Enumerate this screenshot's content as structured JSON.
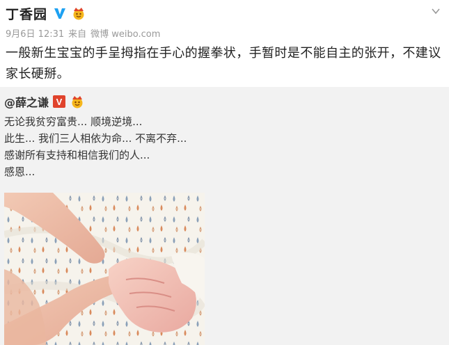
{
  "post": {
    "author": "丁香园",
    "time": "9月6日 12:31",
    "source_prefix": "来自",
    "source": "微博 weibo.com",
    "text": "一般新生宝宝的手呈拇指在手心的握拳状，手暂时是不能自主的张开，不建议家长硬掰。"
  },
  "repost": {
    "author": "@薛之谦",
    "badge": "V",
    "lines": [
      "无论我贫穷富贵... 顺境逆境...",
      "此生... 我们三人相依为命... 不离不弃...",
      "感谢所有支持和相信我们的人...",
      "感恩..."
    ]
  },
  "colors": {
    "verified_blue": "#1da1f2",
    "badge_red": "#e0432c",
    "crown_gold": "#f5b61c"
  }
}
